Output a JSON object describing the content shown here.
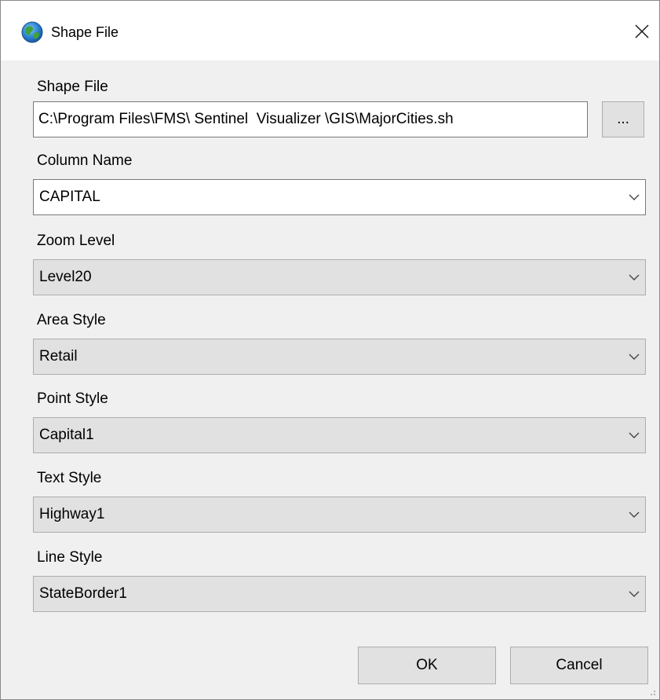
{
  "window": {
    "title": "Shape File",
    "app_icon": "globe-icon",
    "close_icon": "close-icon"
  },
  "shape_file": {
    "label": "Shape File",
    "value": "C:\\Program Files\\FMS\\ Sentinel  Visualizer \\GIS\\MajorCities.sh",
    "browse_label": "..."
  },
  "column_name": {
    "label": "Column Name",
    "value": "CAPITAL"
  },
  "zoom_level": {
    "label": "Zoom Level",
    "value": "Level20"
  },
  "area_style": {
    "label": "Area Style",
    "value": "Retail"
  },
  "point_style": {
    "label": "Point Style",
    "value": "Capital1"
  },
  "text_style": {
    "label": "Text Style",
    "value": "Highway1"
  },
  "line_style": {
    "label": "Line Style",
    "value": "StateBorder1"
  },
  "buttons": {
    "ok_label": "OK",
    "cancel_label": "Cancel"
  },
  "colors": {
    "dialog_background": "#f0f0f0",
    "button_face": "#e1e1e1",
    "border": "#adadad"
  }
}
